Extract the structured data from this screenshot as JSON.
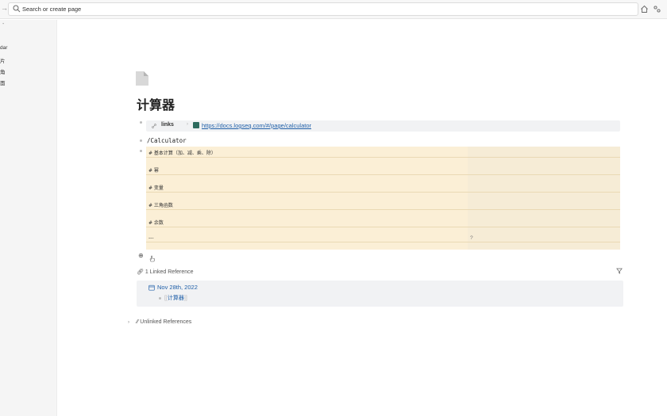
{
  "topbar": {
    "search_placeholder": "Search or create page"
  },
  "sidebar": {
    "items": [
      "dar",
      "片",
      "角",
      "面"
    ]
  },
  "page": {
    "title": "计算器",
    "property": {
      "key": "links",
      "url": "https://docs.logseq.com/#/page/calculator"
    },
    "command": "/Calculator",
    "calc_rows": [
      "# 基本计算（加、减、乘、除）",
      "# 幂",
      "# 变量",
      "# 三角函数",
      "# 余数",
      "---"
    ],
    "calc_result": "?"
  },
  "references": {
    "linked_header": "1 Linked Reference",
    "journal_date": "Nov 28th, 2022",
    "linked_page": "计算器",
    "unlinked_header": "Unlinked References"
  }
}
